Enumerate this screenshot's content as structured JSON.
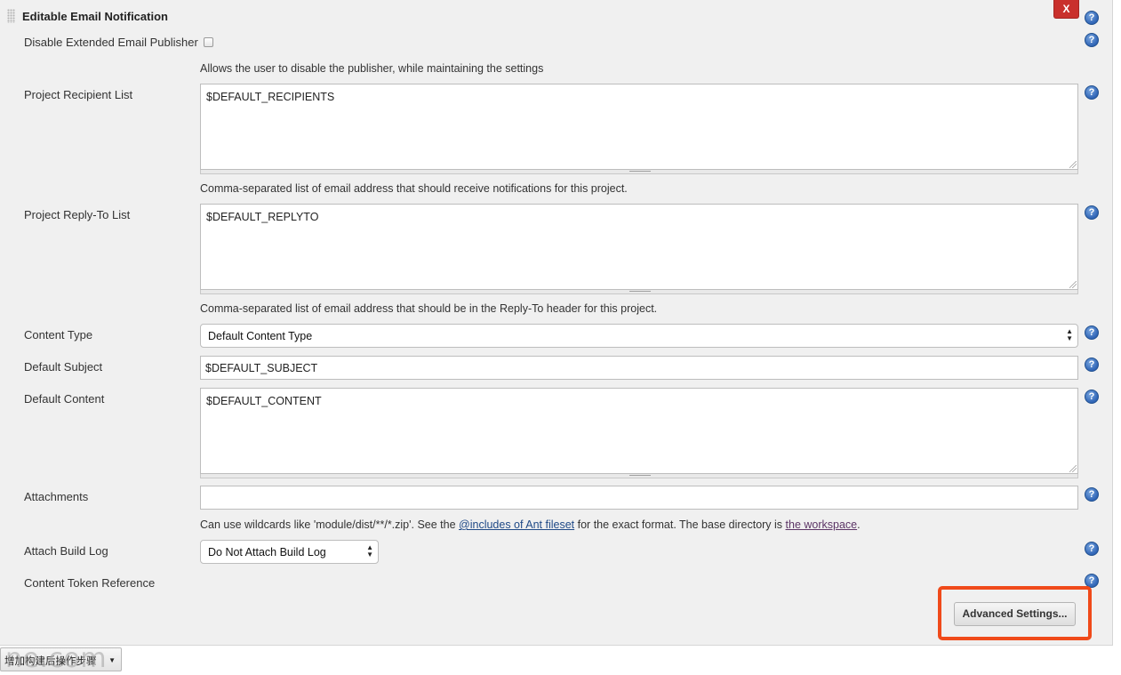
{
  "section": {
    "title": "Editable Email Notification",
    "close_label": "X",
    "help_glyph": "?"
  },
  "disable_publisher": {
    "label": "Disable Extended Email Publisher",
    "checked": false,
    "description": "Allows the user to disable the publisher, while maintaining the settings"
  },
  "recipient_list": {
    "label": "Project Recipient List",
    "value": "$DEFAULT_RECIPIENTS",
    "description": "Comma-separated list of email address that should receive notifications for this project."
  },
  "reply_to_list": {
    "label": "Project Reply-To List",
    "value": "$DEFAULT_REPLYTO",
    "description": "Comma-separated list of email address that should be in the Reply-To header for this project."
  },
  "content_type": {
    "label": "Content Type",
    "selected": "Default Content Type"
  },
  "default_subject": {
    "label": "Default Subject",
    "value": "$DEFAULT_SUBJECT"
  },
  "default_content": {
    "label": "Default Content",
    "value": "$DEFAULT_CONTENT"
  },
  "attachments": {
    "label": "Attachments",
    "value": "",
    "description_prefix": "Can use wildcards like 'module/dist/**/*.zip'. See the ",
    "fileset_link": "@includes of Ant fileset",
    "description_middle": " for the exact format. The base directory is ",
    "workspace_link": "the workspace",
    "description_suffix": "."
  },
  "attach_build_log": {
    "label": "Attach Build Log",
    "selected": "Do Not Attach Build Log"
  },
  "content_token_reference": {
    "label": "Content Token Reference"
  },
  "advanced_button": {
    "label": "Advanced Settings..."
  },
  "bottom_dropdown": {
    "label": "增加构建后操作步骤"
  },
  "watermark": {
    "text": "ne.com"
  },
  "colors": {
    "highlight": "#f04a1a",
    "close": "#c9302c",
    "link": "#204a87",
    "help": "#2f64b5"
  }
}
